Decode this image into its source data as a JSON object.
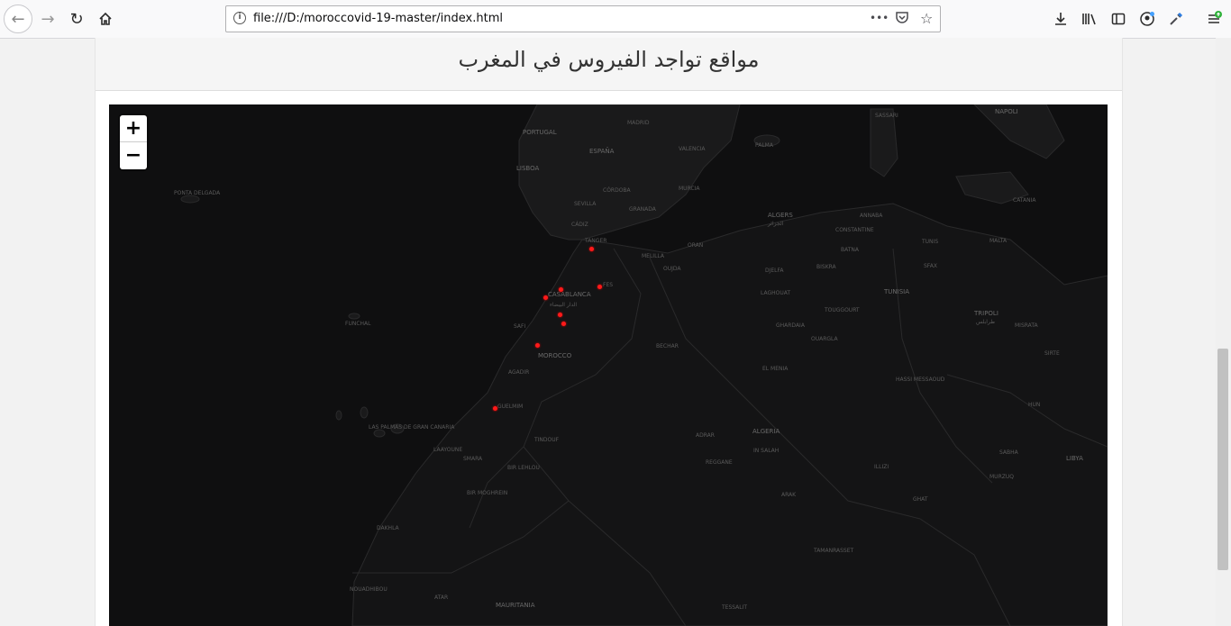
{
  "browser": {
    "url": "file:///D:/moroccovid-19-master/index.html",
    "more_label": "•••"
  },
  "page": {
    "title": "مواقع تواجد الفيروس في المغرب"
  },
  "map": {
    "zoom_in": "+",
    "zoom_out": "−",
    "labels": {
      "madrid": "MADRID",
      "portugal": "PORTUGAL",
      "espana": "ESPAÑA",
      "lisboa": "LISBOA",
      "sevilla": "SEVILLA",
      "cordoba": "CÓRDOBA",
      "granada": "GRANADA",
      "murcia": "MURCIA",
      "valencia": "VALENCIA",
      "palma": "PALMA",
      "sassari": "SASSARI",
      "napoli": "NAPOLI",
      "algers": "ALGERS",
      "algers_ar": "الجزائر",
      "constantine": "CONSTANTINE",
      "annaba": "ANNABA",
      "tunis": "TUNIS",
      "sousse": "SOUSSE",
      "sfax": "SFAX",
      "malta": "MALTA",
      "catania": "CATANIA",
      "tunisia": "TUNISIA",
      "tripoli": "TRIPOLI",
      "tripoli_ar": "طرابلس",
      "misrata": "MISRATA",
      "sirte": "SIRTE",
      "oran": "ORAN",
      "tanger": "TANGER",
      "cadiz": "CÁDIZ",
      "melilla": "MELILLA",
      "oujda": "OUJDA",
      "casablanca": "CASABLANCA",
      "casablanca_ar": "الدار البيضاء",
      "fes": "FES",
      "safi": "SAFI",
      "morocco": "MOROCCO",
      "agadir": "AGADIR",
      "guelmim": "GUELMIM",
      "tifelt": "TIFELT",
      "djelfa": "DJELFA",
      "batna": "BATNA",
      "biskra": "BISKRA",
      "laghouat": "LAGHOUAT",
      "touggourt": "TOUGGOURT",
      "ghardaia": "GHARDAIA",
      "ouargla": "OUARGLA",
      "bechar": "BECHAR",
      "el_menia": "EL MENIA",
      "hassi": "HASSI MESSAOUD",
      "algeria": "ALGERIA",
      "adrar": "ADRAR",
      "in_salah": "IN SALAH",
      "reggane": "REGGANE",
      "tindouf": "TINDOUF",
      "arak": "ARAK",
      "illizi": "ILLIZI",
      "ghat": "GHAT",
      "tamanrasset": "TAMANRASSET",
      "libya": "LIBYA",
      "sabha": "SABHA",
      "murzuq": "MURZUQ",
      "hun": "HUN",
      "laayoune": "LAAYOUNE",
      "smara": "SMARA",
      "bir_lehlou": "BIR LEHLOU",
      "bir_moghrein": "BIR MOGHREIN",
      "dakhla": "DAKHLA",
      "nouadhibou": "NOUADHIBOU",
      "atar": "ATAR",
      "mauritania": "MAURITANIA",
      "tessalit": "TESSALIT",
      "las_palmas": "LAS PALMAS DE GRAN CANARIA",
      "funchal": "FUNCHAL",
      "ponta": "PONTA DELGADA"
    },
    "markers_count": 8
  }
}
